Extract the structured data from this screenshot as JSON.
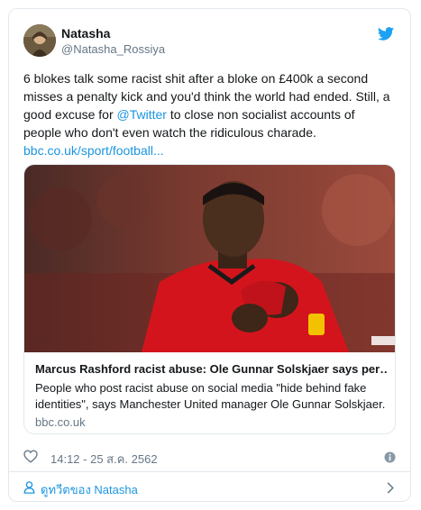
{
  "author": {
    "name": "Natasha",
    "handle": "@Natasha_Rossiya",
    "avatar_icon": "avatar-photo"
  },
  "tweet": {
    "text_part1": "6 blokes talk some racist shit after a bloke on £400k a second misses a penalty kick and you'd think the world had ended. Still, a good excuse for ",
    "mention": "@Twitter",
    "text_part2": " to close non socialist accounts of people who don't even watch the ridiculous charade.",
    "link": "bbc.co.uk/sport/football..."
  },
  "link_card": {
    "title": "Marcus Rashford racist abuse: Ole Gunnar Solskjaer says per…",
    "description": "People who post racist abuse on social media \"hide behind fake identities\", says Manchester United manager Ole Gunnar Solskjaer.",
    "domain": "bbc.co.uk"
  },
  "meta": {
    "timestamp": "14:12 - 25 ส.ค. 2562"
  },
  "footer": {
    "see_more": "ดูทวีตของ Natasha"
  },
  "colors": {
    "link": "#1b95e0",
    "secondary": "#657786",
    "border": "#e1e8ed"
  }
}
